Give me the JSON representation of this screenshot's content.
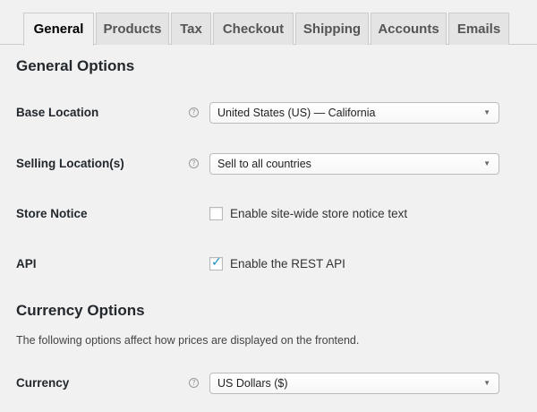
{
  "tabs": [
    {
      "label": "General",
      "active": true
    },
    {
      "label": "Products",
      "active": false
    },
    {
      "label": "Tax",
      "active": false
    },
    {
      "label": "Checkout",
      "active": false
    },
    {
      "label": "Shipping",
      "active": false
    },
    {
      "label": "Accounts",
      "active": false
    },
    {
      "label": "Emails",
      "active": false
    }
  ],
  "general": {
    "title": "General Options",
    "base_location": {
      "label": "Base Location",
      "help_icon": "question-circle-icon",
      "value": "United States (US) — California"
    },
    "selling_locations": {
      "label": "Selling Location(s)",
      "help_icon": "question-circle-icon",
      "value": "Sell to all countries"
    },
    "store_notice": {
      "label": "Store Notice",
      "checkbox_label": "Enable site-wide store notice text",
      "checked": false
    },
    "api": {
      "label": "API",
      "checkbox_label": "Enable the REST API",
      "checked": true
    }
  },
  "currency": {
    "title": "Currency Options",
    "description": "The following options affect how prices are displayed on the frontend.",
    "currency_field": {
      "label": "Currency",
      "help_icon": "question-circle-icon",
      "value": "US Dollars ($)"
    }
  },
  "icons": {
    "help_glyph": "?",
    "caret_glyph": "▼",
    "check_glyph": "✓"
  },
  "colors": {
    "accent": "#1e8cbe",
    "background": "#f1f1f1",
    "tab_inactive": "#e4e4e4"
  }
}
